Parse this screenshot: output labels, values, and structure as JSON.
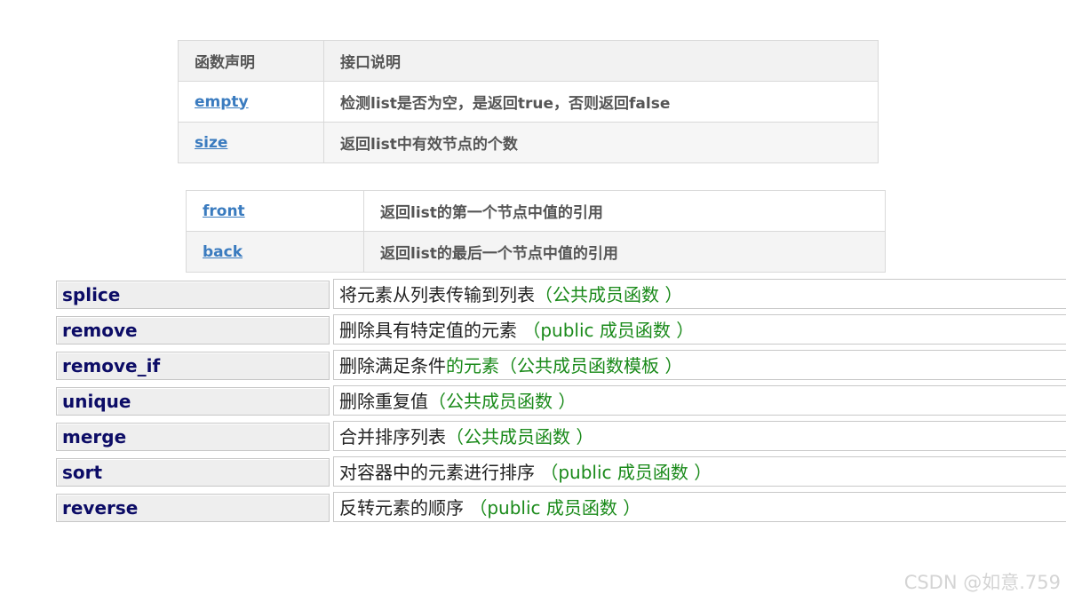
{
  "table1": {
    "header": {
      "col1": "函数声明",
      "col2": "接口说明"
    },
    "rows": [
      {
        "name": "empty",
        "desc": "检测list是否为空，是返回true，否则返回false"
      },
      {
        "name": "size",
        "desc": "返回list中有效节点的个数"
      }
    ]
  },
  "table2": {
    "rows": [
      {
        "name": "front",
        "desc": "返回list的第一个节点中值的引用"
      },
      {
        "name": "back",
        "desc": "返回list的最后一个节点中值的引用"
      }
    ]
  },
  "list": {
    "rows": [
      {
        "name": "splice",
        "desc": "将元素从列表传输到列表",
        "note": "（公共成员函数 ）"
      },
      {
        "name": "remove",
        "desc": "删除具有特定值的元素 ",
        "note": "（public 成员函数 ）"
      },
      {
        "name": "remove_if",
        "desc": "删除满足条件",
        "note": "的元素（公共成员函数模板 ）"
      },
      {
        "name": "unique",
        "desc": "删除重复值",
        "note": "（公共成员函数 ）"
      },
      {
        "name": "merge",
        "desc": "合并排序列表",
        "note": "（公共成员函数 ）"
      },
      {
        "name": "sort",
        "desc": "对容器中的元素进行排序 ",
        "note": "（public 成员函数 ）"
      },
      {
        "name": "reverse",
        "desc": "反转元素的顺序 ",
        "note": "（public 成员函数 ）"
      }
    ]
  },
  "watermark": "CSDN @如意.759",
  "colors": {
    "link": "#3a7bbf",
    "name_text": "#0c0c66",
    "note_text": "#1a8a1a"
  }
}
